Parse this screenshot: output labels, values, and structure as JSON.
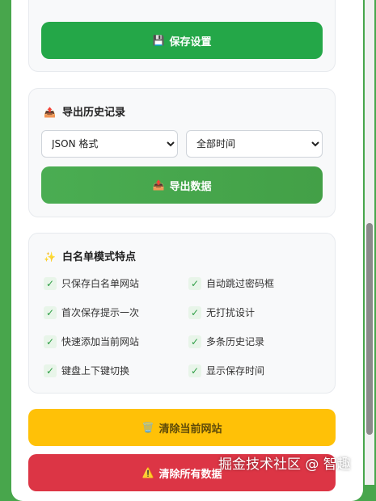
{
  "settings": {
    "save_button": "保存设置",
    "save_icon": "floppy-disk-icon"
  },
  "export": {
    "title": "导出历史记录",
    "title_icon": "outbox-tray-icon",
    "format_selected": "JSON 格式",
    "range_selected": "全部时间",
    "button": "导出数据",
    "button_icon": "outbox-tray-icon"
  },
  "whitelist": {
    "title": "白名单模式特点",
    "title_icon": "sparkles-icon",
    "features": [
      "只保存白名单网站",
      "自动跳过密码框",
      "首次保存提示一次",
      "无打扰设计",
      "快速添加当前网站",
      "多条历史记录",
      "键盘上下键切换",
      "显示保存时间"
    ],
    "check_mark": "✓"
  },
  "actions": {
    "clear_current": "清除当前网站",
    "clear_current_icon": "trash-can-icon",
    "clear_all": "清除所有数据",
    "clear_all_icon": "warning-icon"
  },
  "watermark": "掘金技术社区 @ 智趣",
  "colors": {
    "background": "#48a64c",
    "primary_green": "#24a748",
    "warning_yellow": "#ffc107",
    "danger_red": "#dc3545"
  }
}
